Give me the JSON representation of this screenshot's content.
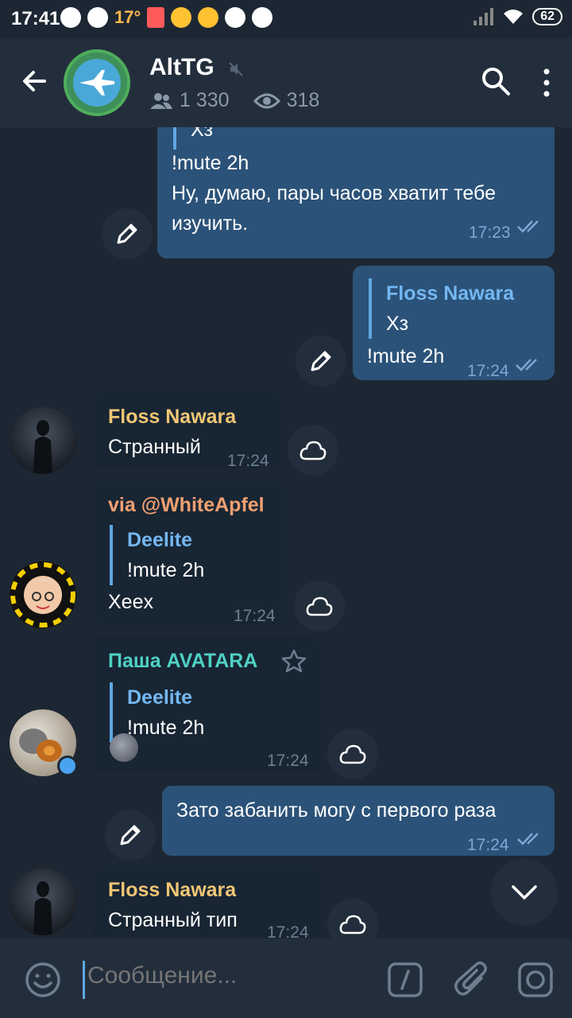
{
  "status_bar": {
    "time": "17:41",
    "temperature": "17°",
    "battery": "62"
  },
  "header": {
    "title": "AltTG",
    "members": "1 330",
    "online": "318"
  },
  "messages": [
    {
      "quote_text": "Хз",
      "text_1": "!mute 2h",
      "text_2": "Ну, думаю, пары часов хватит тебе",
      "text_3": "изучить.",
      "time": "17:23"
    },
    {
      "quote_name": "Floss Nawara",
      "quote_text": "Хз",
      "text": "!mute 2h",
      "time": "17:24"
    },
    {
      "sender": "Floss Nawara",
      "text": "Странный",
      "time": "17:24"
    },
    {
      "sender": "via @WhiteApfel",
      "quote_name": "Deelite",
      "quote_text": "!mute 2h",
      "text": "Xeex",
      "time": "17:24"
    },
    {
      "sender": "Паша AVATARA",
      "quote_name": "Deelite",
      "quote_text": "!mute 2h",
      "time": "17:24"
    },
    {
      "text": "Зато забанить могу с первого раза",
      "time": "17:24"
    },
    {
      "sender": "Floss Nawara",
      "text": "Странный тип",
      "time": "17:24"
    }
  ],
  "composer": {
    "placeholder": "Сообщение..."
  },
  "colors": {
    "background": "#1d2733",
    "header": "#232e3c",
    "outgoing_bubble": "#2b5278",
    "incoming_bubble": "#182533",
    "accent": "#5fa8e0",
    "sender_floss": "#f0c674",
    "sender_via": "#f0a070",
    "sender_pasha": "#4fd1c5"
  },
  "icons": [
    "back-arrow-icon",
    "muted-icon",
    "members-icon",
    "eye-icon",
    "search-icon",
    "more-icon",
    "pencil-icon",
    "cloud-icon",
    "star-icon",
    "chevron-down-icon",
    "emoji-icon",
    "slash-command-icon",
    "paperclip-icon",
    "camera-icon",
    "double-check-icon"
  ]
}
